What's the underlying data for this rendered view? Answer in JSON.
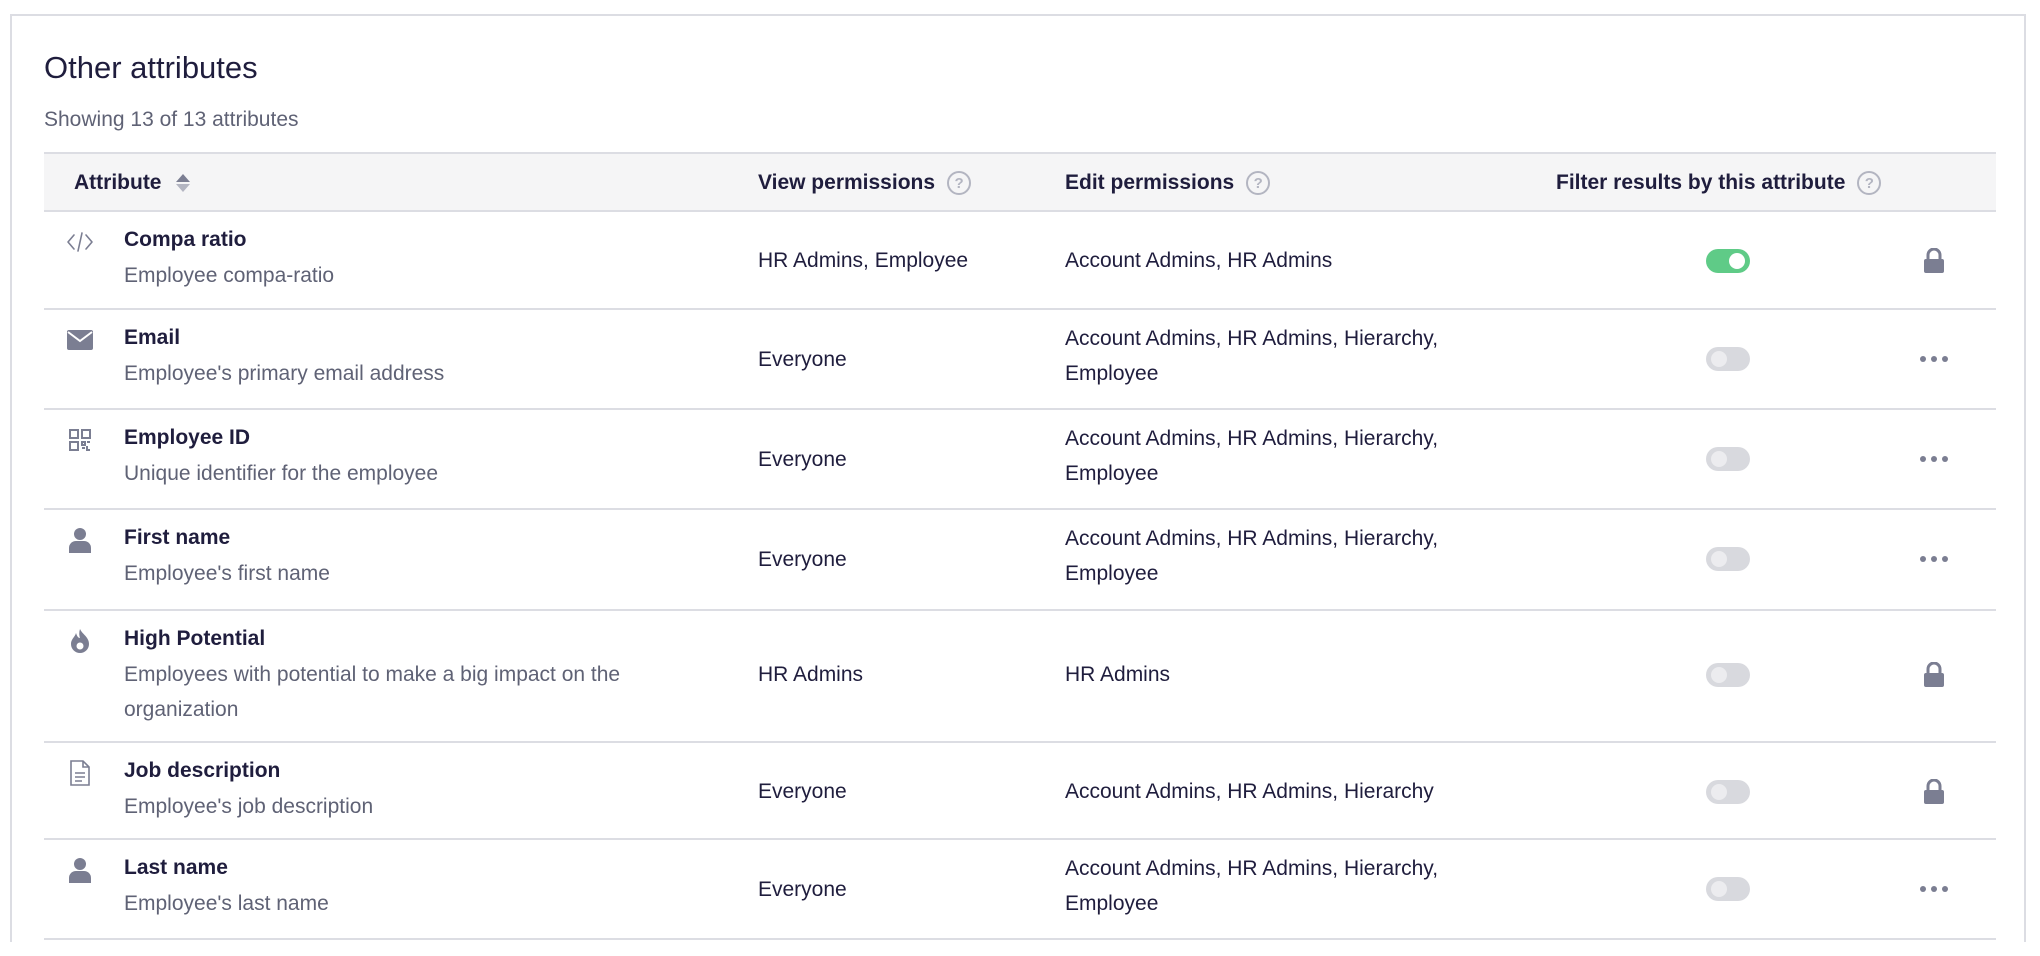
{
  "section": {
    "title": "Other attributes",
    "subtitle": "Showing 13 of 13 attributes"
  },
  "table": {
    "headers": {
      "attribute": "Attribute",
      "view": "View permissions",
      "edit": "Edit permissions",
      "filter": "Filter results by this attribute",
      "help_glyph": "?"
    },
    "rows": [
      {
        "icon": "code-icon",
        "name": "Compa ratio",
        "description": "Employee compa-ratio",
        "view": "HR Admins, Employee",
        "edit_line1": "Account Admins, HR Admins",
        "edit_line2": "",
        "filter_enabled": true,
        "action": "lock"
      },
      {
        "icon": "envelope-icon",
        "name": "Email",
        "description": "Employee's primary email address",
        "view": "Everyone",
        "edit_line1": "Account Admins, HR Admins, Hierarchy,",
        "edit_line2": "Employee",
        "filter_enabled": false,
        "action": "more"
      },
      {
        "icon": "qr-code-icon",
        "name": "Employee ID",
        "description": "Unique identifier for the employee",
        "view": "Everyone",
        "edit_line1": "Account Admins, HR Admins, Hierarchy,",
        "edit_line2": "Employee",
        "filter_enabled": false,
        "action": "more"
      },
      {
        "icon": "person-icon",
        "name": "First name",
        "description": "Employee's first name",
        "view": "Everyone",
        "edit_line1": "Account Admins, HR Admins, Hierarchy,",
        "edit_line2": "Employee",
        "filter_enabled": false,
        "action": "more"
      },
      {
        "icon": "flame-icon",
        "name": "High Potential",
        "description_line1": "Employees with potential to make a big impact on the",
        "description_line2": "organization",
        "view": "HR Admins",
        "edit_line1": "HR Admins",
        "edit_line2": "",
        "filter_enabled": false,
        "action": "lock"
      },
      {
        "icon": "document-icon",
        "name": "Job description",
        "description": "Employee's job description",
        "view": "Everyone",
        "edit_line1": "Account Admins, HR Admins, Hierarchy",
        "edit_line2": "",
        "filter_enabled": false,
        "action": "lock"
      },
      {
        "icon": "person-icon",
        "name": "Last name",
        "description": "Employee's last name",
        "view": "Everyone",
        "edit_line1": "Account Admins, HR Admins, Hierarchy,",
        "edit_line2": "Employee",
        "filter_enabled": false,
        "action": "more"
      }
    ]
  },
  "colors": {
    "toggle_on": "#5fcb87",
    "toggle_off": "#d8d9de",
    "icon_gray": "#7b7e92",
    "border": "#dcdde3"
  }
}
